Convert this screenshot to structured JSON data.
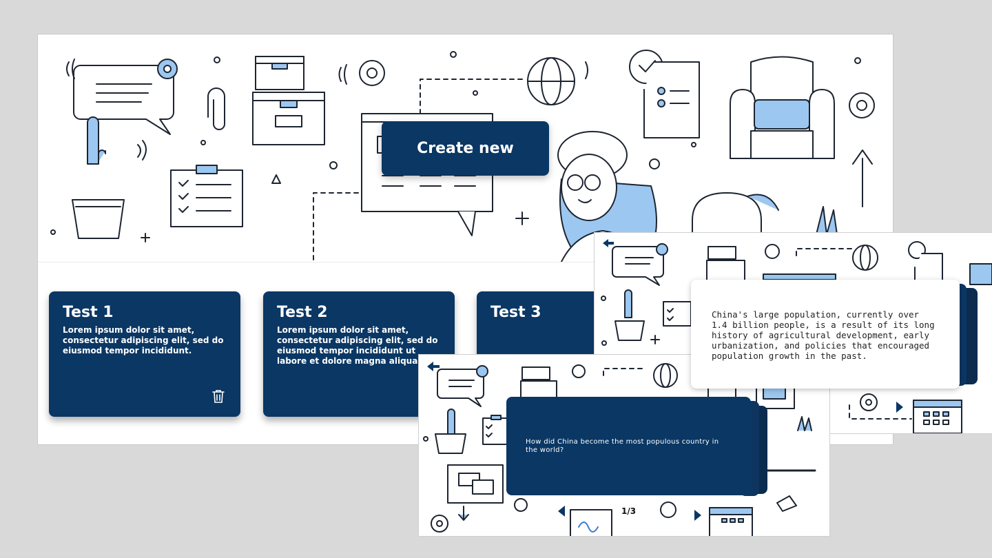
{
  "main": {
    "create_label": "Create new",
    "cards": [
      {
        "title": "Test 1",
        "text": "Lorem ipsum dolor sit amet, consectetur adipiscing elit, sed do eiusmod tempor incididunt."
      },
      {
        "title": "Test 2",
        "text": "Lorem ipsum dolor sit amet, consectetur adipiscing elit, sed do eiusmod tempor incididunt ut labore et dolore magna aliqua."
      },
      {
        "title": "Test 3",
        "text": ""
      }
    ],
    "delete_icon": "trash-icon"
  },
  "answer_view": {
    "text": "China's large population, currently over 1.4 billion people, is a result of its long history of agricultural development, early urbanization, and policies that encouraged population growth in the past."
  },
  "question_view": {
    "text": "How did China become the most populous country in the world?",
    "counter": "1/3"
  },
  "colors": {
    "accent": "#0a3764",
    "illustration_blue": "#9cc7f0",
    "background": "#d9d9d9"
  }
}
